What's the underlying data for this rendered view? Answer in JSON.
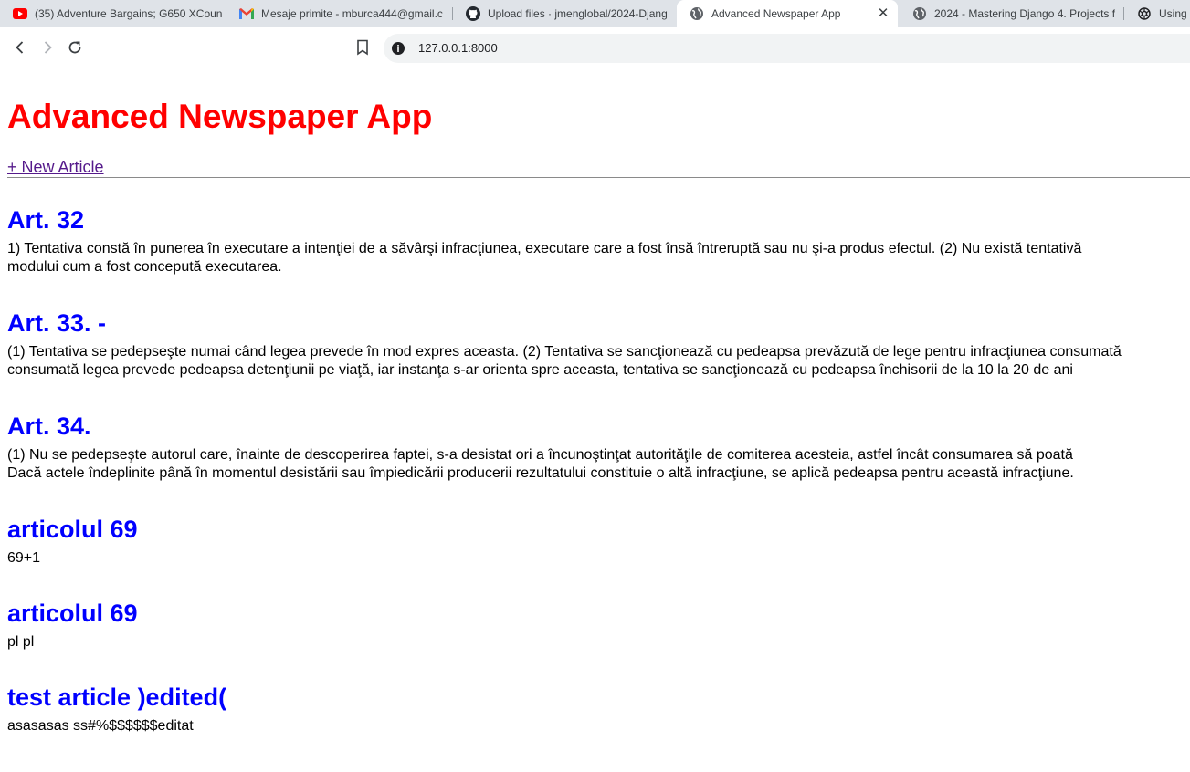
{
  "browser": {
    "tabs": [
      {
        "title": "(35) Adventure Bargains; G650 XCoun",
        "icon": "youtube-icon",
        "active": false
      },
      {
        "title": "Mesaje primite - mburca444@gmail.c",
        "icon": "gmail-icon",
        "active": false
      },
      {
        "title": "Upload files · jmenglobal/2024-Djang",
        "icon": "github-icon",
        "active": false
      },
      {
        "title": "Advanced Newspaper App",
        "icon": "globe-icon",
        "active": true
      },
      {
        "title": "2024 - Mastering Django 4. Projects f",
        "icon": "globe-icon",
        "active": false
      },
      {
        "title": "Using",
        "icon": "openai-icon",
        "active": false
      }
    ],
    "url": "127.0.0.1:8000"
  },
  "page": {
    "title": "Advanced Newspaper App",
    "new_article_link": "+ New Article",
    "articles": [
      {
        "title": "Art. 32",
        "lines": [
          "1) Tentativa constă în punerea în executare a intenţiei de a săvârşi infracţiunea, executare care a fost însă întreruptă sau nu şi-a produs efectul. (2) Nu există tentativă",
          "modului cum a fost concepută executarea."
        ]
      },
      {
        "title": "Art. 33. -",
        "lines": [
          "(1) Tentativa se pedepseşte numai când legea prevede în mod expres aceasta. (2) Tentativa se sancţionează cu pedeapsa prevăzută de lege pentru infracţiunea consumată",
          "consumată legea prevede pedeapsa detenţiunii pe viaţă, iar instanţa s-ar orienta spre aceasta, tentativa se sancţionează cu pedeapsa închisorii de la 10 la 20 de ani"
        ]
      },
      {
        "title": "Art. 34.",
        "lines": [
          "(1) Nu se pedepseşte autorul care, înainte de descoperirea faptei, s-a desistat ori a încunoştinţat autorităţile de comiterea acesteia, astfel încât consumarea să poată",
          "Dacă actele îndeplinite până în momentul desistării sau împiedicării producerii rezultatului constituie o altă infracţiune, se aplică pedeapsa pentru această infracţiune."
        ]
      },
      {
        "title": "articolul 69",
        "lines": [
          "69+1"
        ]
      },
      {
        "title": "articolul 69",
        "lines": [
          "pl pl"
        ]
      },
      {
        "title": "test article )edited(",
        "lines": [
          "asasasas ss#%$$$$$$editat"
        ]
      }
    ]
  },
  "colors": {
    "title": "#ff0000",
    "article_heading": "#0000ff",
    "visited_link": "#551a8b"
  }
}
